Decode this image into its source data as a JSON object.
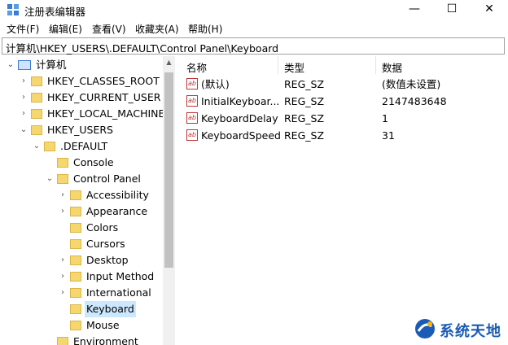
{
  "window": {
    "title": "注册表编辑器",
    "minimize_glyph": "—",
    "maximize_glyph": "☐",
    "close_glyph": "✕"
  },
  "menu": [
    "文件(F)",
    "编辑(E)",
    "查看(V)",
    "收藏夹(A)",
    "帮助(H)"
  ],
  "address": "计算机\\HKEY_USERS\\.DEFAULT\\Control Panel\\Keyboard",
  "tree": [
    {
      "label": "计算机",
      "twisty": "⌄",
      "indent": 0,
      "type": "pc"
    },
    {
      "label": "HKEY_CLASSES_ROOT",
      "twisty": "›",
      "indent": 1
    },
    {
      "label": "HKEY_CURRENT_USER",
      "twisty": "›",
      "indent": 1
    },
    {
      "label": "HKEY_LOCAL_MACHINE",
      "twisty": "›",
      "indent": 1
    },
    {
      "label": "HKEY_USERS",
      "twisty": "⌄",
      "indent": 1
    },
    {
      "label": ".DEFAULT",
      "twisty": "⌄",
      "indent": 2
    },
    {
      "label": "Console",
      "twisty": "",
      "indent": 3
    },
    {
      "label": "Control Panel",
      "twisty": "⌄",
      "indent": 3
    },
    {
      "label": "Accessibility",
      "twisty": "›",
      "indent": 4
    },
    {
      "label": "Appearance",
      "twisty": "›",
      "indent": 4
    },
    {
      "label": "Colors",
      "twisty": "",
      "indent": 4
    },
    {
      "label": "Cursors",
      "twisty": "",
      "indent": 4
    },
    {
      "label": "Desktop",
      "twisty": "›",
      "indent": 4
    },
    {
      "label": "Input Method",
      "twisty": "›",
      "indent": 4
    },
    {
      "label": "International",
      "twisty": "›",
      "indent": 4
    },
    {
      "label": "Keyboard",
      "twisty": "",
      "indent": 4,
      "selected": true
    },
    {
      "label": "Mouse",
      "twisty": "",
      "indent": 4
    },
    {
      "label": "Environment",
      "twisty": "",
      "indent": 3
    }
  ],
  "columns": {
    "name": "名称",
    "type": "类型",
    "data": "数据"
  },
  "values": [
    {
      "name": "(默认)",
      "type": "REG_SZ",
      "data": "(数值未设置)"
    },
    {
      "name": "InitialKeyboar...",
      "type": "REG_SZ",
      "data": "2147483648"
    },
    {
      "name": "KeyboardDelay",
      "type": "REG_SZ",
      "data": "1"
    },
    {
      "name": "KeyboardSpeed",
      "type": "REG_SZ",
      "data": "31"
    }
  ],
  "value_icon_text": "ab",
  "watermark": {
    "text": "系统天地"
  },
  "colors": {
    "selection": "#cce8ff",
    "folder": "#f5d76e",
    "watermark": "#1b5bb5"
  }
}
